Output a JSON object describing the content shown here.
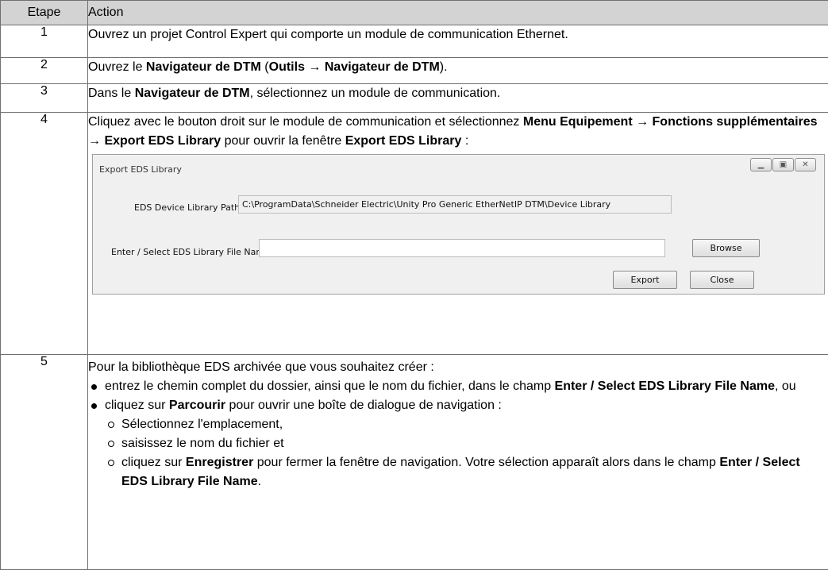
{
  "table": {
    "headers": {
      "step": "Etape",
      "action": "Action"
    },
    "rows": [
      {
        "num": "1",
        "text": "Ouvrez un projet Control Expert qui comporte un module de communication Ethernet."
      },
      {
        "num": "2",
        "t1": "Ouvrez le ",
        "b1": "Navigateur de DTM",
        "t2": " (",
        "b2": "Outils",
        "t3": " → ",
        "b3": "Navigateur de DTM",
        "t4": ")."
      },
      {
        "num": "3",
        "t1": "Dans le ",
        "b1": "Navigateur de DTM",
        "t2": ", sélectionnez un module de communication."
      },
      {
        "num": "4",
        "t1": "Cliquez avec le bouton droit sur le module de communication et sélectionnez ",
        "b1": "Menu Equipement",
        "t2": " → ",
        "b2": "Fonctions supplémentaires",
        "t3": " → ",
        "b3": "Export EDS Library",
        "t4": " pour ouvrir la fenêtre ",
        "b4": "Export EDS Library",
        "t5": " :"
      },
      {
        "num": "5",
        "intro": "Pour la bibliothèque EDS archivée que vous souhaitez créer :",
        "bullet1": {
          "t1": "entrez le chemin complet du dossier, ainsi que le nom du fichier, dans le champ ",
          "b1": "Enter / Select EDS Library File Name",
          "t2": ", ou"
        },
        "bullet2": {
          "t1": "cliquez sur ",
          "b1": "Parcourir",
          "t2": " pour ouvrir une boîte de dialogue de navigation :"
        },
        "sub1": "Sélectionnez l'emplacement,",
        "sub2": "saisissez le nom du fichier et",
        "sub3": {
          "t1": "cliquez sur ",
          "b1": "Enregistrer",
          "t2": " pour fermer la fenêtre de navigation. Votre sélection apparaît alors dans le champ ",
          "b2": "Enter / Select EDS Library File Name",
          "t3": "."
        }
      }
    ]
  },
  "dialog": {
    "title": "Export EDS Library",
    "path_label": "EDS Device Library Path :",
    "path_value": "C:\\ProgramData\\Schneider Electric\\Unity Pro Generic EtherNetIP DTM\\Device Library",
    "file_label": "Enter / Select EDS Library File Name:",
    "file_value": "",
    "browse_label": "Browse",
    "export_label": "Export",
    "close_label": "Close",
    "icons": [
      "minimize-icon",
      "maximize-icon",
      "close-icon"
    ]
  }
}
